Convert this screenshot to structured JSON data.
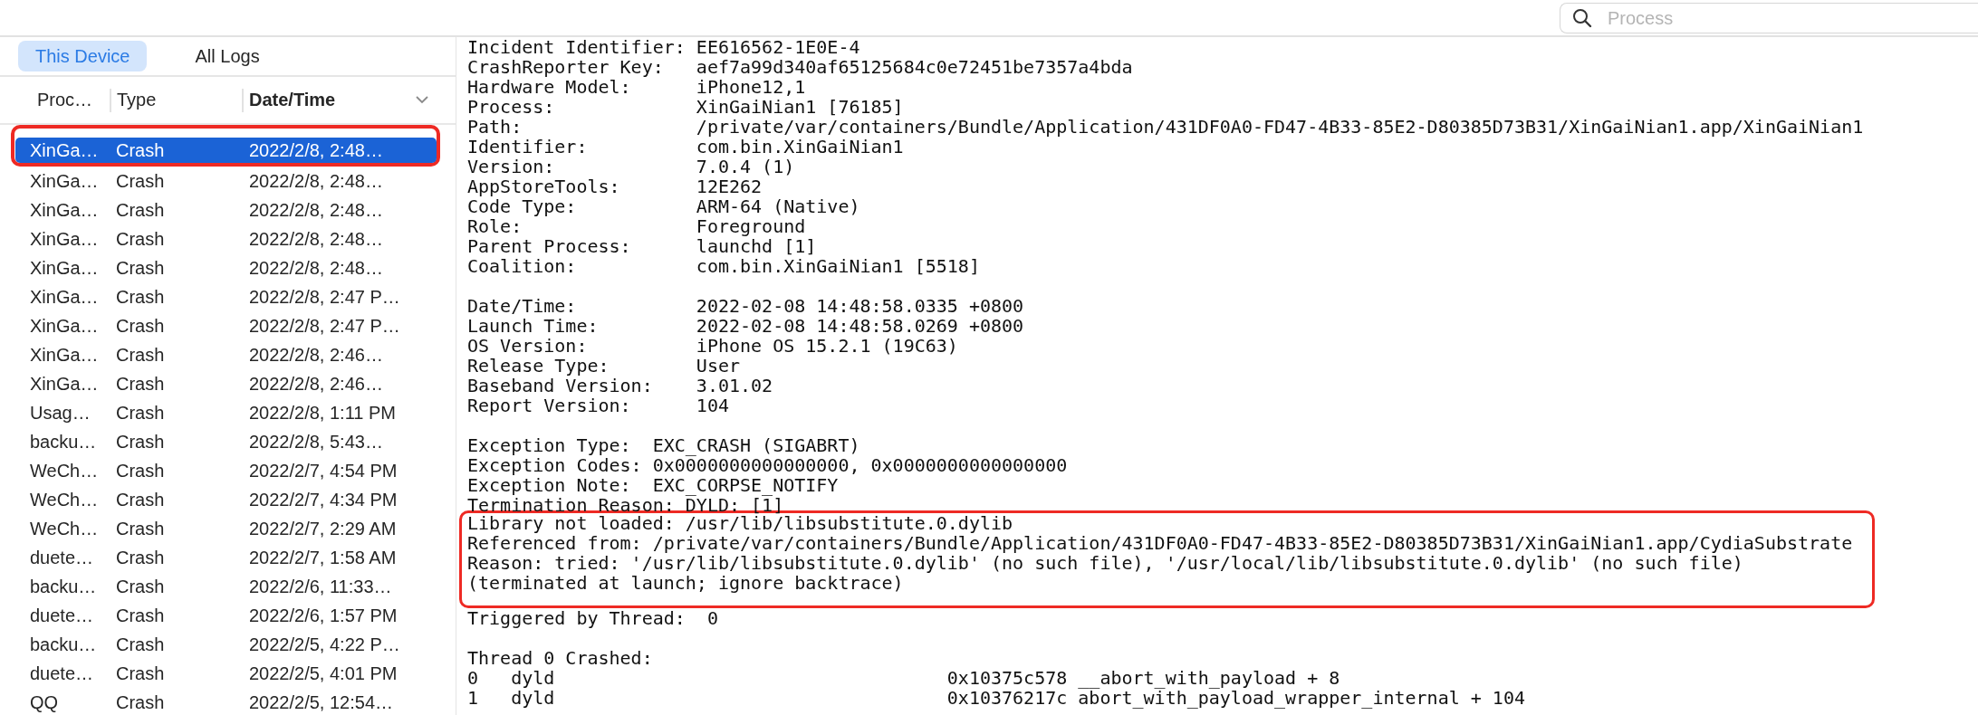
{
  "search": {
    "placeholder": "Process"
  },
  "scope_tabs": [
    {
      "label": "This Device",
      "selected": true
    },
    {
      "label": "All Logs",
      "selected": false
    }
  ],
  "log_list": {
    "columns": [
      {
        "label": "Proc…",
        "sorted": false
      },
      {
        "label": "Type",
        "sorted": false
      },
      {
        "label": "Date/Time",
        "sorted": true
      }
    ],
    "rows": [
      {
        "process": "XinGa…",
        "type": "Crash",
        "date_time": "2022/2/8, 2:48…",
        "selected": true,
        "highlighted": true
      },
      {
        "process": "XinGa…",
        "type": "Crash",
        "date_time": "2022/2/8, 2:48…",
        "selected": false,
        "highlighted": false
      },
      {
        "process": "XinGa…",
        "type": "Crash",
        "date_time": "2022/2/8, 2:48…",
        "selected": false,
        "highlighted": false
      },
      {
        "process": "XinGa…",
        "type": "Crash",
        "date_time": "2022/2/8, 2:48…",
        "selected": false,
        "highlighted": false
      },
      {
        "process": "XinGa…",
        "type": "Crash",
        "date_time": "2022/2/8, 2:48…",
        "selected": false,
        "highlighted": false
      },
      {
        "process": "XinGa…",
        "type": "Crash",
        "date_time": "2022/2/8, 2:47 P…",
        "selected": false,
        "highlighted": false
      },
      {
        "process": "XinGa…",
        "type": "Crash",
        "date_time": "2022/2/8, 2:47 P…",
        "selected": false,
        "highlighted": false
      },
      {
        "process": "XinGa…",
        "type": "Crash",
        "date_time": "2022/2/8, 2:46…",
        "selected": false,
        "highlighted": false
      },
      {
        "process": "XinGa…",
        "type": "Crash",
        "date_time": "2022/2/8, 2:46…",
        "selected": false,
        "highlighted": false
      },
      {
        "process": "Usag…",
        "type": "Crash",
        "date_time": "2022/2/8, 1:11 PM",
        "selected": false,
        "highlighted": false
      },
      {
        "process": "backu…",
        "type": "Crash",
        "date_time": "2022/2/8, 5:43…",
        "selected": false,
        "highlighted": false
      },
      {
        "process": "WeCh…",
        "type": "Crash",
        "date_time": "2022/2/7, 4:54 PM",
        "selected": false,
        "highlighted": false
      },
      {
        "process": "WeCh…",
        "type": "Crash",
        "date_time": "2022/2/7, 4:34 PM",
        "selected": false,
        "highlighted": false
      },
      {
        "process": "WeCh…",
        "type": "Crash",
        "date_time": "2022/2/7, 2:29 AM",
        "selected": false,
        "highlighted": false
      },
      {
        "process": "duete…",
        "type": "Crash",
        "date_time": "2022/2/7, 1:58 AM",
        "selected": false,
        "highlighted": false
      },
      {
        "process": "backu…",
        "type": "Crash",
        "date_time": "2022/2/6, 11:33…",
        "selected": false,
        "highlighted": false
      },
      {
        "process": "duete…",
        "type": "Crash",
        "date_time": "2022/2/6, 1:57 PM",
        "selected": false,
        "highlighted": false
      },
      {
        "process": "backu…",
        "type": "Crash",
        "date_time": "2022/2/5, 4:22 P…",
        "selected": false,
        "highlighted": false
      },
      {
        "process": "duete…",
        "type": "Crash",
        "date_time": "2022/2/5, 4:01 PM",
        "selected": false,
        "highlighted": false
      },
      {
        "process": "QQ",
        "type": "Crash",
        "date_time": "2022/2/5, 12:54…",
        "selected": false,
        "highlighted": false
      }
    ]
  },
  "report": {
    "blocks": [
      {
        "highlighted": false,
        "lines": [
          "Incident Identifier: EE616562-1E0E-4",
          "CrashReporter Key:   aef7a99d340af65125684c0e72451be7357a4bda",
          "Hardware Model:      iPhone12,1",
          "Process:             XinGaiNian1 [76185]",
          "Path:                /private/var/containers/Bundle/Application/431DF0A0-FD47-4B33-85E2-D80385D73B31/XinGaiNian1.app/XinGaiNian1",
          "Identifier:          com.bin.XinGaiNian1",
          "Version:             7.0.4 (1)",
          "AppStoreTools:       12E262",
          "Code Type:           ARM-64 (Native)",
          "Role:                Foreground",
          "Parent Process:      launchd [1]",
          "Coalition:           com.bin.XinGaiNian1 [5518]"
        ]
      },
      {
        "highlighted": false,
        "lines": [
          "Date/Time:           2022-02-08 14:48:58.0335 +0800",
          "Launch Time:         2022-02-08 14:48:58.0269 +0800",
          "OS Version:          iPhone OS 15.2.1 (19C63)",
          "Release Type:        User",
          "Baseband Version:    3.01.02",
          "Report Version:      104"
        ]
      },
      {
        "highlighted": false,
        "lines": [
          "Exception Type:  EXC_CRASH (SIGABRT)",
          "Exception Codes: 0x0000000000000000, 0x0000000000000000",
          "Exception Note:  EXC_CORPSE_NOTIFY",
          "Termination Reason: DYLD: [1]"
        ]
      },
      {
        "highlighted": true,
        "lines": [
          "Library not loaded: /usr/lib/libsubstitute.0.dylib",
          "Referenced from: /private/var/containers/Bundle/Application/431DF0A0-FD47-4B33-85E2-D80385D73B31/XinGaiNian1.app/CydiaSubstrate",
          "Reason: tried: '/usr/lib/libsubstitute.0.dylib' (no such file), '/usr/local/lib/libsubstitute.0.dylib' (no such file)",
          "(terminated at launch; ignore backtrace)"
        ]
      },
      {
        "highlighted": false,
        "lines": [
          "Triggered by Thread:  0"
        ]
      },
      {
        "highlighted": false,
        "lines": [
          "Thread 0 Crashed:",
          "0   dyld                                    0x10375c578 __abort_with_payload + 8",
          "1   dyld                                    0x10376217c abort_with_payload_wrapper_internal + 104"
        ]
      }
    ]
  }
}
